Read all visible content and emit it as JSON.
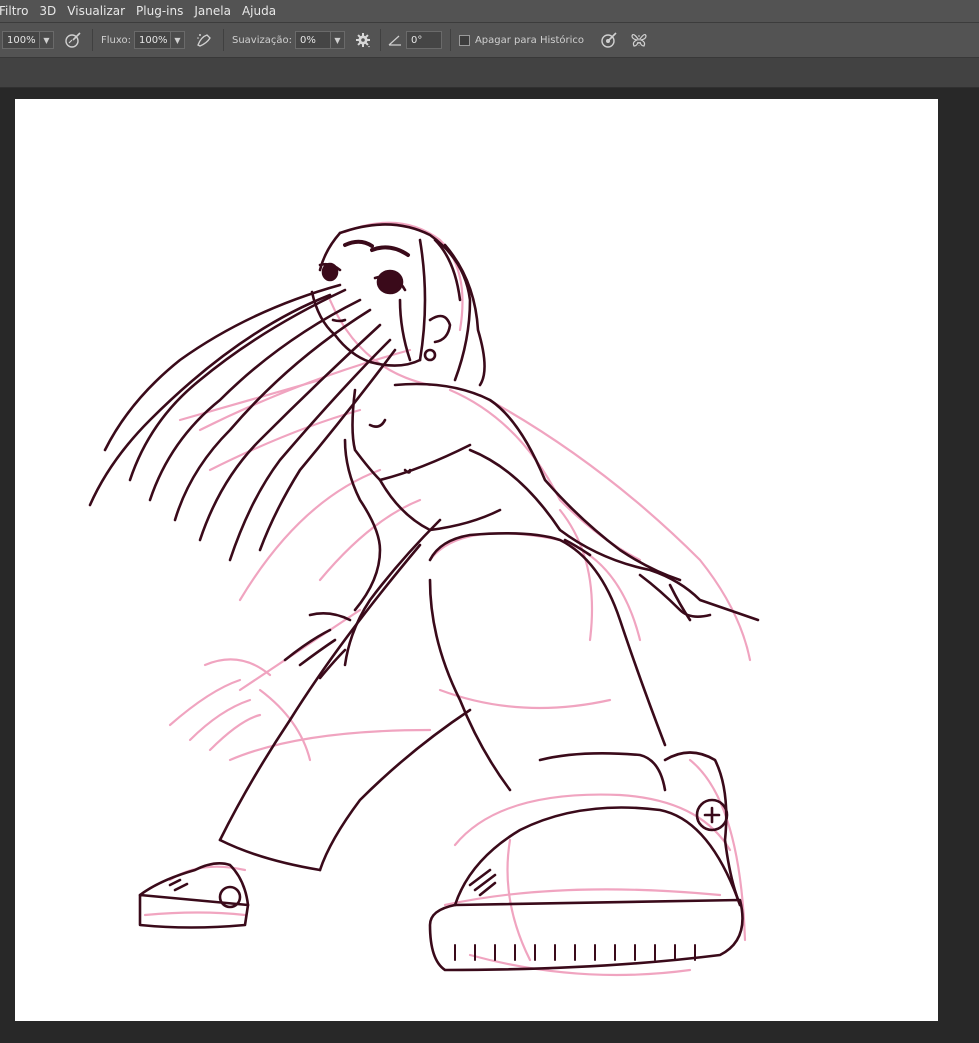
{
  "menubar": {
    "items": [
      "Filtro",
      "3D",
      "Visualizar",
      "Plug-ins",
      "Janela",
      "Ajuda"
    ]
  },
  "options": {
    "opacity_value": "100%",
    "flow_label": "Fluxo:",
    "flow_value": "100%",
    "smoothing_label": "Suavização:",
    "smoothing_value": "0%",
    "angle_value": "0°",
    "erase_history_label": "Apagar para Histórico"
  },
  "icons": {
    "pressure_opacity": "pen-pressure-icon",
    "airbrush": "airbrush-icon",
    "smoothing_settings": "gear-icon",
    "angle": "angle-icon",
    "pressure_size": "pen-pressure-size-icon",
    "symmetry": "butterfly-symmetry-icon"
  },
  "colors": {
    "ui_bg": "#535353",
    "workspace": "#282828",
    "canvas": "#ffffff",
    "ink": "#3a0a1a",
    "sketch": "#f0a0bd"
  }
}
